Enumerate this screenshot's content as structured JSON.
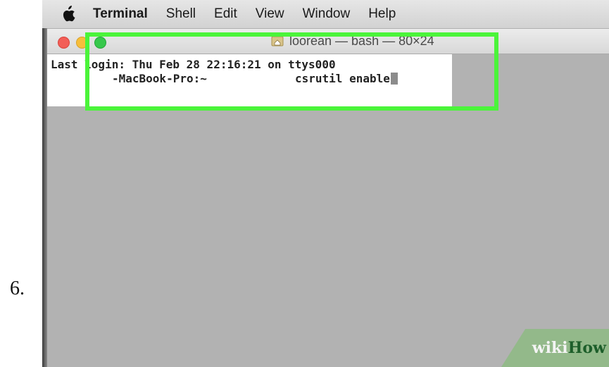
{
  "step": {
    "number": "6."
  },
  "menubar": {
    "apple_icon": "apple-logo-icon",
    "items": [
      {
        "label": "Terminal"
      },
      {
        "label": "Shell"
      },
      {
        "label": "Edit"
      },
      {
        "label": "View"
      },
      {
        "label": "Window"
      },
      {
        "label": "Help"
      }
    ]
  },
  "window": {
    "title": "loorean — bash — 80×24",
    "title_icon": "home-folder-icon",
    "traffic_colors": {
      "close": "#f25e57",
      "minimize": "#f7be3b",
      "zoom": "#37c84c"
    }
  },
  "terminal": {
    "last_login": "Last login: Thu Feb 28 22:16:21 on ttys000",
    "prompt": "-MacBook-Pro:~",
    "command": "csrutil enable"
  },
  "highlight": {
    "color": "#4bf43a"
  },
  "watermark": {
    "part1": "wiki",
    "part2": "How"
  }
}
